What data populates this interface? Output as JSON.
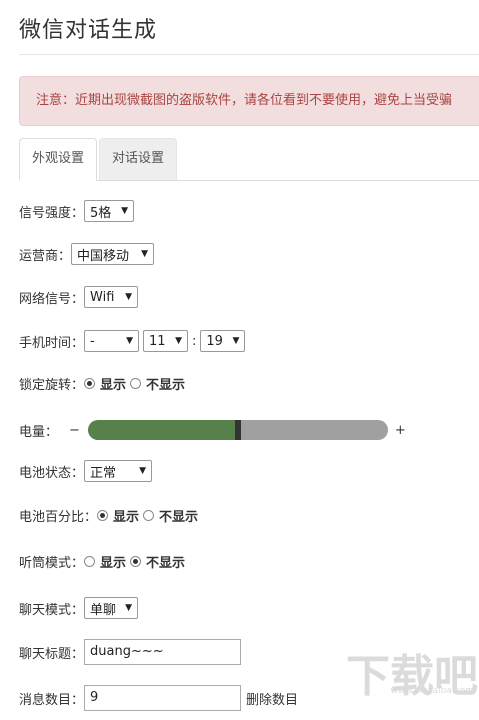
{
  "page": {
    "title": "微信对话生成",
    "notice": "注意：近期出现微截图的盗版软件，请各位看到不要使用，避免上当受骗"
  },
  "tabs": [
    {
      "label": "外观设置",
      "active": true
    },
    {
      "label": "对话设置",
      "active": false
    }
  ],
  "form": {
    "signal_strength": {
      "label": "信号强度：",
      "value": "5格"
    },
    "carrier": {
      "label": "运营商：",
      "value": "中国移动"
    },
    "network": {
      "label": "网络信号：",
      "value": "Wifi"
    },
    "phone_time": {
      "label": "手机时间：",
      "period": "-",
      "hour": "11",
      "separator": ":",
      "minute": "19"
    },
    "rotation_lock": {
      "label": "锁定旋转：",
      "options": [
        "显示",
        "不显示"
      ],
      "selected": "显示"
    },
    "battery": {
      "label": "电量：",
      "minus": "−",
      "plus": "+",
      "level_fraction": 0.5
    },
    "battery_status": {
      "label": "电池状态：",
      "value": "正常"
    },
    "battery_percent": {
      "label": "电池百分比：",
      "options": [
        "显示",
        "不显示"
      ],
      "selected": "显示"
    },
    "earpiece_mode": {
      "label": "听筒模式：",
      "options": [
        "显示",
        "不显示"
      ],
      "selected": "不显示"
    },
    "chat_mode": {
      "label": "聊天模式：",
      "value": "单聊"
    },
    "chat_title": {
      "label": "聊天标题：",
      "value": "duang~~~"
    },
    "message_count": {
      "label": "消息数目：",
      "value": "9",
      "action": "删除数目"
    }
  },
  "watermark": {
    "text": "下载吧",
    "sub": "www.xiazaiba.com"
  },
  "colors": {
    "alert_bg": "#f2dede",
    "alert_text": "#a94442",
    "battery_fill": "#58804a",
    "battery_track": "#a0a0a0"
  }
}
